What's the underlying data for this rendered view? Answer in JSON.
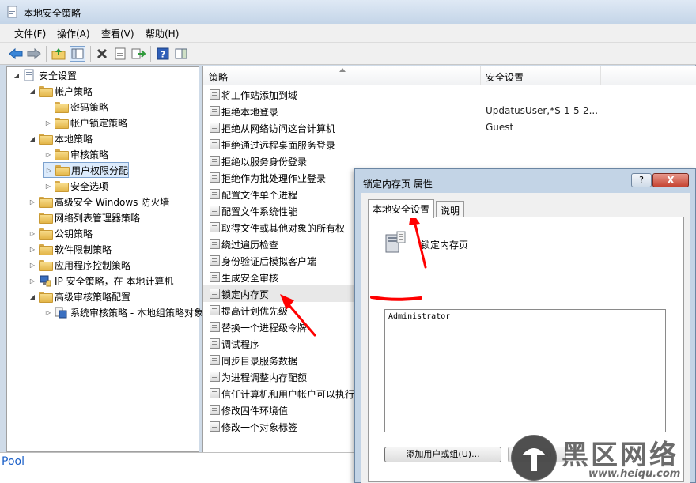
{
  "window": {
    "title": "本地安全策略"
  },
  "menu": [
    "文件(F)",
    "操作(A)",
    "查看(V)",
    "帮助(H)"
  ],
  "toolbar_icons": [
    "back-icon",
    "forward-icon",
    "up-folder-icon",
    "show-tree-icon",
    "delete-icon",
    "properties-icon",
    "export-icon",
    "help-icon",
    "panel-icon"
  ],
  "tree": [
    {
      "label": "安全设置",
      "level": 0,
      "twisty": "open",
      "icon": "security-icon"
    },
    {
      "label": "帐户策略",
      "level": 1,
      "twisty": "open",
      "icon": "folder"
    },
    {
      "label": "密码策略",
      "level": 2,
      "twisty": "",
      "icon": "folder"
    },
    {
      "label": "帐户锁定策略",
      "level": 2,
      "twisty": "closed",
      "icon": "folder"
    },
    {
      "label": "本地策略",
      "level": 1,
      "twisty": "open",
      "icon": "folder"
    },
    {
      "label": "审核策略",
      "level": 2,
      "twisty": "closed",
      "icon": "folder"
    },
    {
      "label": "用户权限分配",
      "level": 2,
      "twisty": "closed",
      "icon": "folder",
      "selected": true
    },
    {
      "label": "安全选项",
      "level": 2,
      "twisty": "closed",
      "icon": "folder"
    },
    {
      "label": "高级安全 Windows 防火墙",
      "level": 1,
      "twisty": "closed",
      "icon": "folder"
    },
    {
      "label": "网络列表管理器策略",
      "level": 1,
      "twisty": "",
      "icon": "folder"
    },
    {
      "label": "公钥策略",
      "level": 1,
      "twisty": "closed",
      "icon": "folder"
    },
    {
      "label": "软件限制策略",
      "level": 1,
      "twisty": "closed",
      "icon": "folder"
    },
    {
      "label": "应用程序控制策略",
      "level": 1,
      "twisty": "closed",
      "icon": "folder"
    },
    {
      "label": "IP 安全策略，在 本地计算机",
      "level": 1,
      "twisty": "closed",
      "icon": "ip-security-icon"
    },
    {
      "label": "高级审核策略配置",
      "level": 1,
      "twisty": "open",
      "icon": "folder"
    },
    {
      "label": "系统审核策略 - 本地组策略对象",
      "level": 2,
      "twisty": "closed",
      "icon": "audit-icon"
    }
  ],
  "list": {
    "columns": [
      "策略",
      "安全设置"
    ],
    "rows": [
      {
        "name": "将工作站添加到域",
        "value": ""
      },
      {
        "name": "拒绝本地登录",
        "value": "UpdatusUser,*S-1-5-2..."
      },
      {
        "name": "拒绝从网络访问这台计算机",
        "value": "Guest"
      },
      {
        "name": "拒绝通过远程桌面服务登录",
        "value": ""
      },
      {
        "name": "拒绝以服务身份登录",
        "value": ""
      },
      {
        "name": "拒绝作为批处理作业登录",
        "value": ""
      },
      {
        "name": "配置文件单个进程",
        "value": ""
      },
      {
        "name": "配置文件系统性能",
        "value": ""
      },
      {
        "name": "取得文件或其他对象的所有权",
        "value": ""
      },
      {
        "name": "绕过遍历检查",
        "value": ""
      },
      {
        "name": "身份验证后模拟客户端",
        "value": ""
      },
      {
        "name": "生成安全审核",
        "value": ""
      },
      {
        "name": "锁定内存页",
        "value": "",
        "selected": true
      },
      {
        "name": "提高计划优先级",
        "value": ""
      },
      {
        "name": "替换一个进程级令牌",
        "value": ""
      },
      {
        "name": "调试程序",
        "value": ""
      },
      {
        "name": "同步目录服务数据",
        "value": ""
      },
      {
        "name": "为进程调整内存配额",
        "value": ""
      },
      {
        "name": "信任计算机和用户帐户可以执行",
        "value": ""
      },
      {
        "name": "修改固件环境值",
        "value": ""
      },
      {
        "name": "修改一个对象标签",
        "value": ""
      }
    ]
  },
  "status": {
    "link": "Pool"
  },
  "dialog": {
    "title": "锁定内存页 属性",
    "help_label": "?",
    "close_label": "X",
    "tabs": [
      "本地安全设置",
      "说明"
    ],
    "policy_name": "锁定内存页",
    "users": [
      "Administrator"
    ],
    "add_button": "添加用户或组(U)...",
    "remove_button": "删除(R)"
  },
  "watermark": {
    "text": "黑区网络",
    "url": "www.heiqu.com"
  },
  "colors": {
    "annotation": "#ff0000",
    "selection": "#dcebfc",
    "link": "#1a5fc8"
  }
}
